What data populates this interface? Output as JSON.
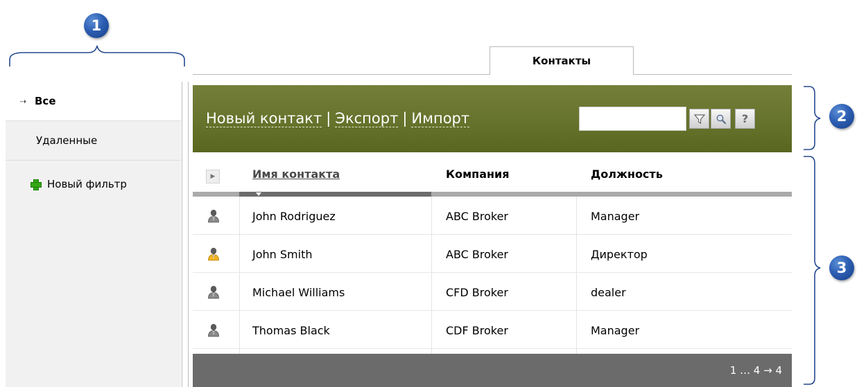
{
  "callouts": [
    "1",
    "2",
    "3"
  ],
  "tabs": [
    {
      "label": "Контакты",
      "active": true
    }
  ],
  "sidebar": {
    "items": [
      {
        "label": "Все",
        "active": true,
        "icon": "arrow-right-icon"
      },
      {
        "label": "Удаленные",
        "active": false
      },
      {
        "label": "Новый фильтр",
        "active": false,
        "icon": "plus-icon"
      }
    ]
  },
  "toolbar": {
    "new_contact": "Новый контакт",
    "export": "Экспорт",
    "import": "Импорт",
    "separator": "|",
    "search_value": "",
    "buttons": [
      "filter-icon",
      "search-icon",
      "help-icon"
    ],
    "help_label": "?"
  },
  "grid": {
    "columns": [
      "Имя контакта",
      "Компания",
      "Должность"
    ],
    "sorted_column": "Имя контакта",
    "rows": [
      {
        "icon": "contact-person-icon",
        "name": "John Rodriguez",
        "company": "ABC Broker",
        "position": "Manager"
      },
      {
        "icon": "contact-person-highlighted-icon",
        "name": "John Smith",
        "company": "ABC Broker",
        "position": "Директор"
      },
      {
        "icon": "contact-person-icon",
        "name": "Michael Williams",
        "company": "CFD Broker",
        "position": "dealer"
      },
      {
        "icon": "contact-person-icon",
        "name": "Thomas Black",
        "company": "CDF Broker",
        "position": "Manager"
      }
    ]
  },
  "pager": {
    "text": "1 … 4 → 4"
  },
  "colors": {
    "toolbar_bg": "#66732c",
    "badge": "#2d5eb3",
    "pager_bg": "#6b6b6b",
    "sidebar_bg": "#f1f1f1",
    "new_filter_plus": "#35a615"
  }
}
